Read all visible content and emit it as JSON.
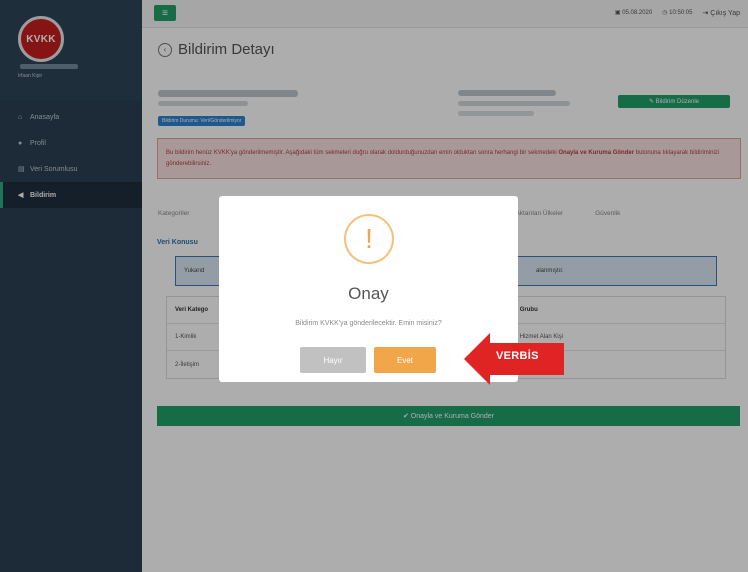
{
  "sidebar": {
    "logo_text": "KVKK",
    "user_name": "Irfaan Kipir",
    "items": [
      {
        "icon": "home-icon",
        "glyph": "⌂",
        "label": "Anasayfa"
      },
      {
        "icon": "user-icon",
        "glyph": "●",
        "label": "Profil"
      },
      {
        "icon": "database-icon",
        "glyph": "▤",
        "label": "Veri Sorumlusu"
      },
      {
        "icon": "megaphone-icon",
        "glyph": "◀",
        "label": "Bildirim"
      }
    ]
  },
  "topbar": {
    "menu_glyph": "≡",
    "date": "05.08.2020",
    "time": "10:50:05",
    "logout_label": "Çıkış Yap"
  },
  "page": {
    "title": "Bildirim Detayı",
    "status_badge": "Bildirim Durumu: Veri/Gönderilmiyor",
    "edit_label": "Bildirim Düzenle",
    "alert_text": "Bu bildirim henüz KVKK'ya gönderilmemiştir. Aşağıdaki tüm sekmeleri doğru olarak doldurduğunuzdan emin olduktan sonra herhangi bir sekmedeki",
    "alert_bold": "Onayla ve Kuruma Gönder",
    "alert_tail": " butonuna tıklayarak bildiriminizi gönderebilirsiniz.",
    "tabs": [
      "Kategoriler",
      "",
      "",
      "Aktarılan Ülkeler",
      "Güvenlik"
    ],
    "section_title": "Veri Konusu",
    "info_left": "Yukarıd",
    "info_right": "alanmıştır.",
    "table": {
      "headers": [
        "Veri Katego",
        "Grubu"
      ],
      "rows": [
        [
          "1-Kimlik",
          "Hizmet Alan Kişi"
        ],
        [
          "2-İletişim",
          ""
        ]
      ]
    },
    "approve_label": "✔ Onayla ve Kuruma Gönder"
  },
  "modal": {
    "icon": "warning-icon",
    "glyph": "!",
    "title": "Onay",
    "text": "Bildirim KVKK'ya gönderilecektir. Emin misiniz?",
    "no_label": "Hayır",
    "yes_label": "Evet"
  },
  "callout": {
    "label": "VERBİS",
    "color": "#e02424"
  },
  "colors": {
    "accent_green": "#22a06b",
    "warning_orange": "#f2a64a",
    "sidebar_bg": "#2b3f52"
  }
}
